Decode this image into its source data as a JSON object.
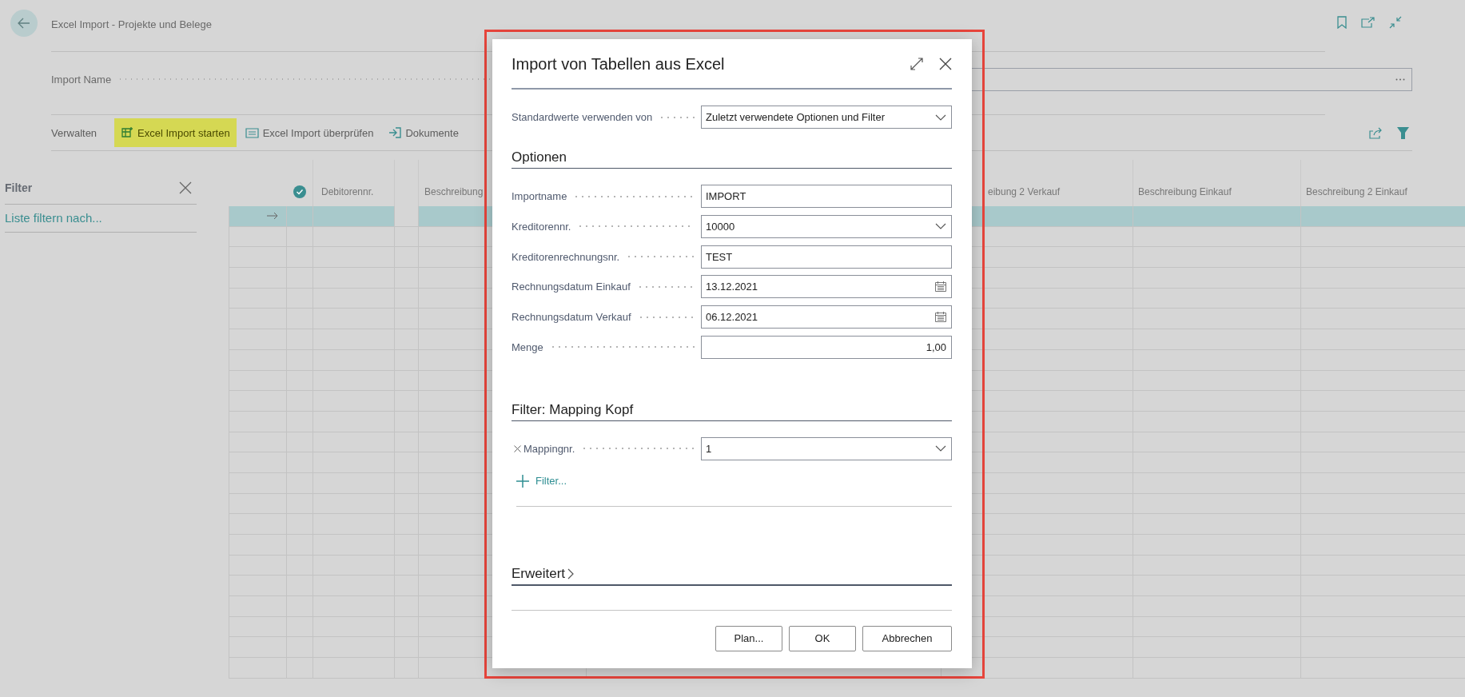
{
  "page": {
    "title": "Excel Import - Projekte und Belege"
  },
  "header_fields": [
    {
      "label": "Import Name"
    }
  ],
  "actions": [
    {
      "label": "Verwalten",
      "kind": "menu",
      "highlighted": false
    },
    {
      "label": "Excel Import starten",
      "kind": "excel",
      "highlighted": true
    },
    {
      "label": "Excel Import überprüfen",
      "kind": "review",
      "highlighted": false
    },
    {
      "label": "Dokumente",
      "kind": "import",
      "highlighted": false
    }
  ],
  "filter_pane": {
    "title": "Filter",
    "link": "Liste filtern nach..."
  },
  "table": {
    "columns": [
      {
        "kind": "arrow"
      },
      {
        "kind": "check"
      },
      {
        "kind": "text",
        "label": "Debitorennr."
      },
      {
        "kind": "gap"
      },
      {
        "kind": "text",
        "label": "Beschreibung"
      },
      {
        "kind": "blank"
      },
      {
        "kind": "text",
        "label": "eibung 2 Verkauf"
      },
      {
        "kind": "text",
        "label": "Beschreibung Einkauf"
      },
      {
        "kind": "text",
        "label": "Beschreibung 2 Einkauf"
      }
    ],
    "rows": [
      {
        "selected": true
      },
      {
        "selected": false
      },
      {
        "selected": false
      },
      {
        "selected": false
      },
      {
        "selected": false
      },
      {
        "selected": false
      },
      {
        "selected": false
      },
      {
        "selected": false
      },
      {
        "selected": false
      },
      {
        "selected": false
      },
      {
        "selected": false
      },
      {
        "selected": false
      },
      {
        "selected": false
      },
      {
        "selected": false
      },
      {
        "selected": false
      },
      {
        "selected": false
      },
      {
        "selected": false
      },
      {
        "selected": false
      },
      {
        "selected": false
      },
      {
        "selected": false
      },
      {
        "selected": false
      },
      {
        "selected": false
      },
      {
        "selected": false
      }
    ]
  },
  "dialog": {
    "title": "Import von Tabellen aus Excel",
    "defaults": {
      "label": "Standardwerte verwenden von",
      "value": "Zuletzt verwendete Optionen und Filter"
    },
    "options": {
      "title": "Optionen",
      "fields": [
        {
          "label": "Importname",
          "value": "IMPORT",
          "kind": "text"
        },
        {
          "label": "Kreditorennr.",
          "value": "10000",
          "kind": "select"
        },
        {
          "label": "Kreditorenrechnungsnr.",
          "value": "TEST",
          "kind": "text"
        },
        {
          "label": "Rechnungsdatum Einkauf",
          "value": "13.12.2021",
          "kind": "date"
        },
        {
          "label": "Rechnungsdatum Verkauf",
          "value": "06.12.2021",
          "kind": "date"
        },
        {
          "label": "Menge",
          "value": "1,00",
          "kind": "number"
        }
      ]
    },
    "filter": {
      "title": "Filter: Mapping Kopf",
      "filters": [
        {
          "label": "Mappingnr.",
          "value": "1"
        }
      ],
      "add_filter": "Filter..."
    },
    "advanced": {
      "title": "Erweitert",
      "expanded": false
    },
    "buttons": [
      "Plan...",
      "OK",
      "Abbrechen"
    ]
  }
}
